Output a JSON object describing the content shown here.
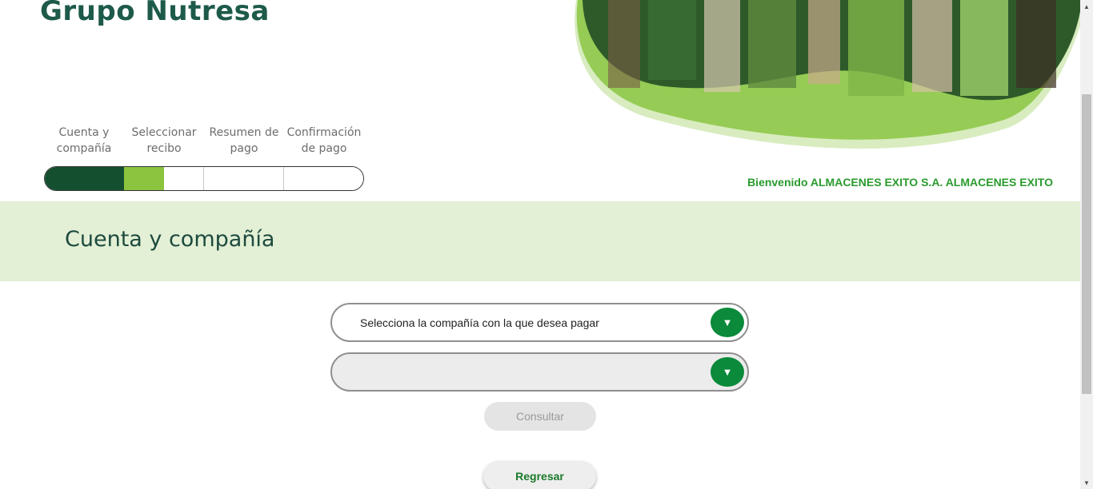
{
  "brand": {
    "title": "Grupo Nutresa"
  },
  "steps": [
    {
      "label": "Cuenta y compañía"
    },
    {
      "label": "Seleccionar recibo"
    },
    {
      "label": "Resumen de pago"
    },
    {
      "label": "Confirmación de pago"
    }
  ],
  "welcome": {
    "text": "Bienvenido ALMACENES EXITO S.A. ALMACENES EXITO"
  },
  "section": {
    "title": "Cuenta y compañía"
  },
  "form": {
    "company_select": {
      "value": "Selecciona la compañía con la que desea pagar",
      "icon": "chevron-down-icon"
    },
    "account_select": {
      "value": "",
      "icon": "chevron-down-icon"
    },
    "consultar_label": "Consultar",
    "regresar_label": "Regresar"
  },
  "colors": {
    "brand": "#1d5a4a",
    "accent_green": "#0a8a3a",
    "light_green": "#8cc43f",
    "band": "#e3f0d6",
    "welcome": "#2a9b2e"
  }
}
